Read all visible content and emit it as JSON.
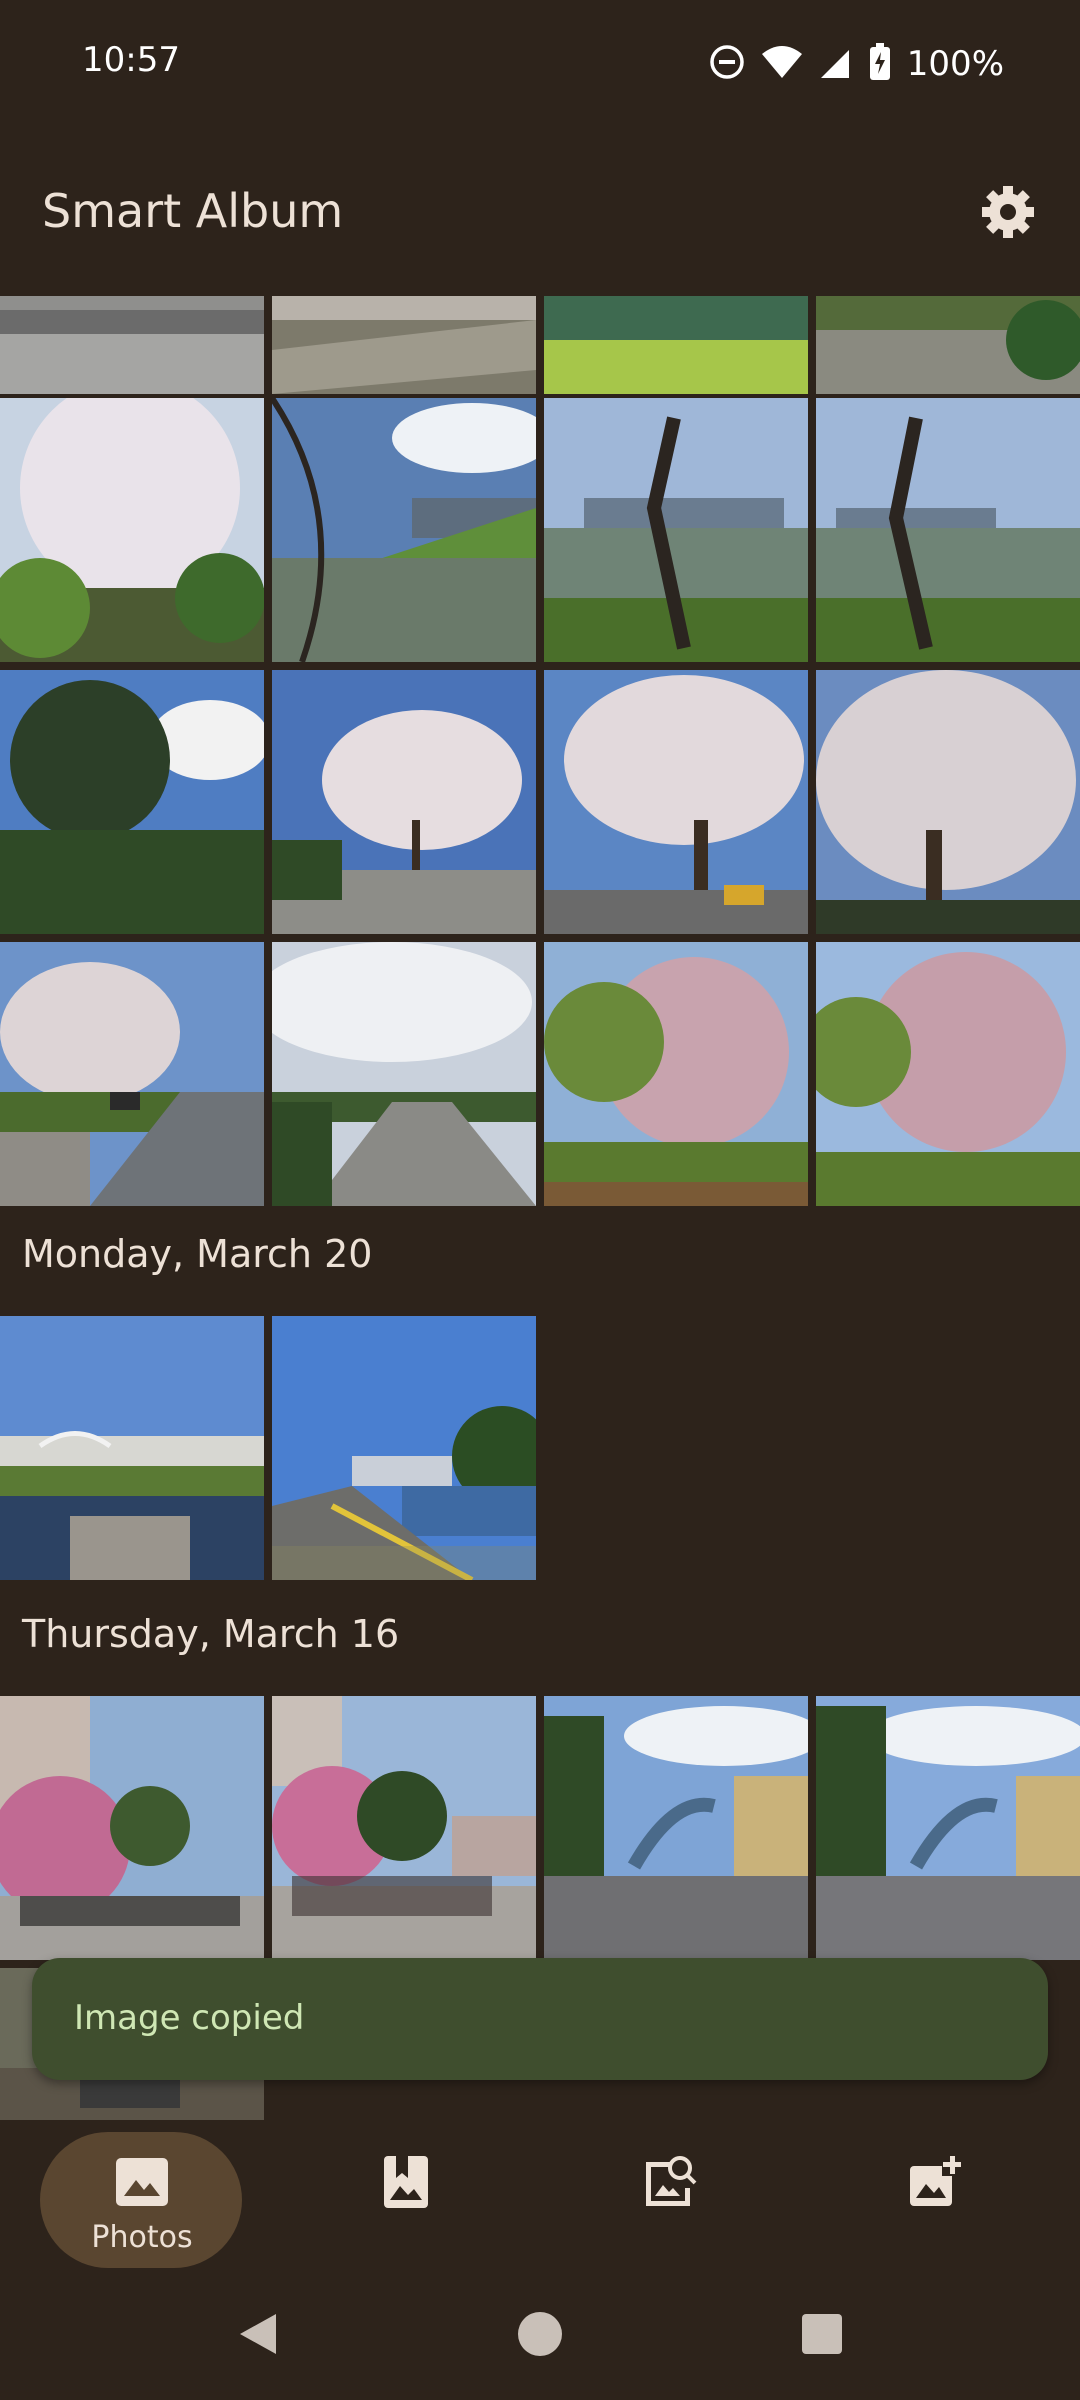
{
  "status_bar": {
    "time": "10:57",
    "battery": "100%",
    "icons": [
      "do-not-disturb-icon",
      "wifi-icon",
      "signal-icon",
      "battery-charging-icon"
    ]
  },
  "app_bar": {
    "title": "Smart Album",
    "settings_icon": "gear-icon"
  },
  "sections": {
    "first": {
      "date": ""
    },
    "second": {
      "date": "Monday, March 20"
    },
    "third": {
      "date": "Thursday, March 16"
    }
  },
  "snackbar": {
    "message": "Image copied"
  },
  "bottom_nav": {
    "items": [
      {
        "label": "Photos",
        "icon": "photos-icon",
        "active": true
      },
      {
        "label": "",
        "icon": "albums-icon",
        "active": false
      },
      {
        "label": "",
        "icon": "image-search-icon",
        "active": false
      },
      {
        "label": "",
        "icon": "add-photo-icon",
        "active": false
      }
    ]
  },
  "system_nav": {
    "buttons": [
      "back-icon",
      "home-icon",
      "recents-icon"
    ]
  },
  "colors": {
    "background": "#2d231b",
    "snackbar": "#3f4e2e",
    "nav_pill": "#5a4630",
    "text": "#ede1d6"
  }
}
